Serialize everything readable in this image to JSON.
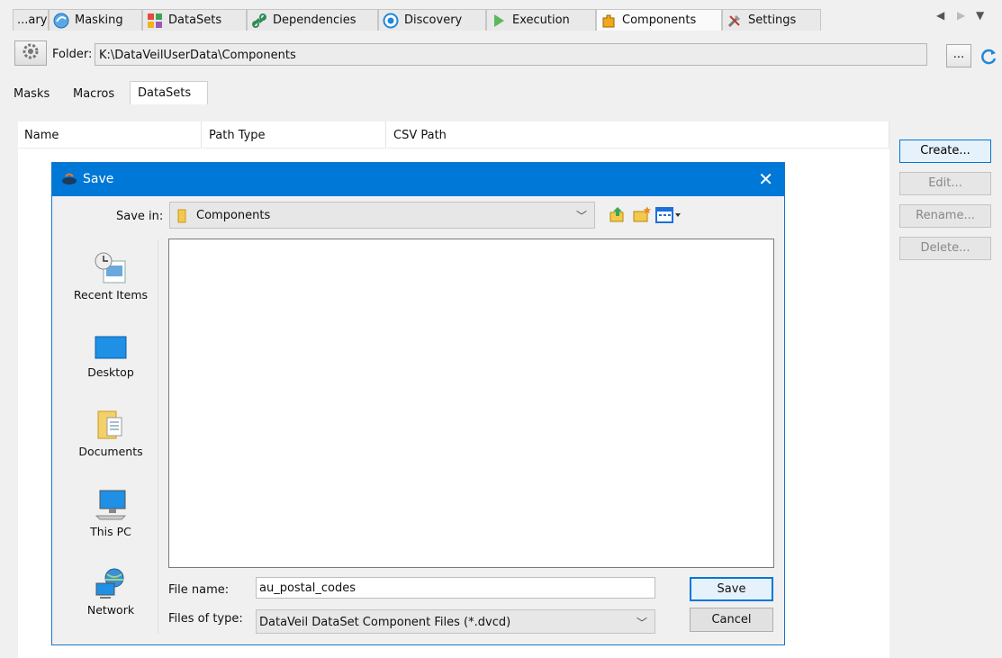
{
  "top_tabs": [
    {
      "label": "...ary",
      "icon": "library-icon"
    },
    {
      "label": "Masking",
      "icon": "masking-icon"
    },
    {
      "label": "DataSets",
      "icon": "datasets-icon"
    },
    {
      "label": "Dependencies",
      "icon": "dependencies-icon"
    },
    {
      "label": "Discovery",
      "icon": "discovery-icon"
    },
    {
      "label": "Execution",
      "icon": "execution-icon"
    },
    {
      "label": "Components",
      "icon": "components-icon",
      "active": true
    },
    {
      "label": "Settings",
      "icon": "settings-icon"
    }
  ],
  "folder": {
    "label": "Folder:",
    "path": "K:\\DataVeilUserData\\Components",
    "browse_label": "..."
  },
  "sub_tabs": [
    {
      "label": "Masks"
    },
    {
      "label": "Macros"
    },
    {
      "label": "DataSets",
      "active": true
    }
  ],
  "table": {
    "columns": [
      "Name",
      "Path Type",
      "CSV Path"
    ]
  },
  "actions": {
    "create": "Create...",
    "edit": "Edit...",
    "rename": "Rename...",
    "delete": "Delete..."
  },
  "dialog": {
    "title": "Save",
    "save_in_label": "Save in:",
    "save_in_value": "Components",
    "places": [
      "Recent Items",
      "Desktop",
      "Documents",
      "This PC",
      "Network"
    ],
    "file_name_label": "File name:",
    "file_name_value": "au_postal_codes",
    "file_type_label": "Files of type:",
    "file_type_value": "DataVeil DataSet Component Files (*.dvcd)",
    "save_button": "Save",
    "cancel_button": "Cancel"
  },
  "colors": {
    "title_bar": "#0078d7",
    "accent": "#0078d7"
  }
}
